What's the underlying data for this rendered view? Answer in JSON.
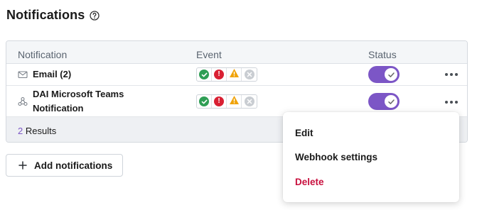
{
  "header": {
    "title": "Notifications",
    "help_icon": "question-circle-icon"
  },
  "table": {
    "columns": [
      "Notification",
      "Event",
      "Status"
    ],
    "rows": [
      {
        "name": "Email (2)",
        "type_icon": "envelope-icon",
        "events": [
          {
            "icon": "check-icon",
            "color": "#2f9e55"
          },
          {
            "icon": "exclamation-icon",
            "color": "#d92033"
          },
          {
            "icon": "warning-icon",
            "color": "#f0a30a"
          },
          {
            "icon": "x-icon",
            "color": "#c9cdd2"
          }
        ],
        "status_on": true
      },
      {
        "name_line1": "DAI Microsoft Teams",
        "name_line2": "Notification",
        "type_icon": "webhook-icon",
        "events": [
          {
            "icon": "check-icon",
            "color": "#2f9e55"
          },
          {
            "icon": "exclamation-icon",
            "color": "#d92033"
          },
          {
            "icon": "warning-icon",
            "color": "#f0a30a"
          },
          {
            "icon": "x-icon",
            "color": "#c9cdd2"
          }
        ],
        "status_on": true
      }
    ],
    "footer": {
      "count": "2",
      "label": "Results"
    }
  },
  "add_button": {
    "icon": "plus-icon",
    "label": "Add notifications"
  },
  "context_menu": {
    "items": [
      {
        "label": "Edit"
      },
      {
        "label": "Webhook settings"
      },
      {
        "label": "Delete",
        "color": "#c8103e"
      }
    ]
  },
  "colors": {
    "accent": "#7c56c6",
    "danger": "#c8103e"
  }
}
